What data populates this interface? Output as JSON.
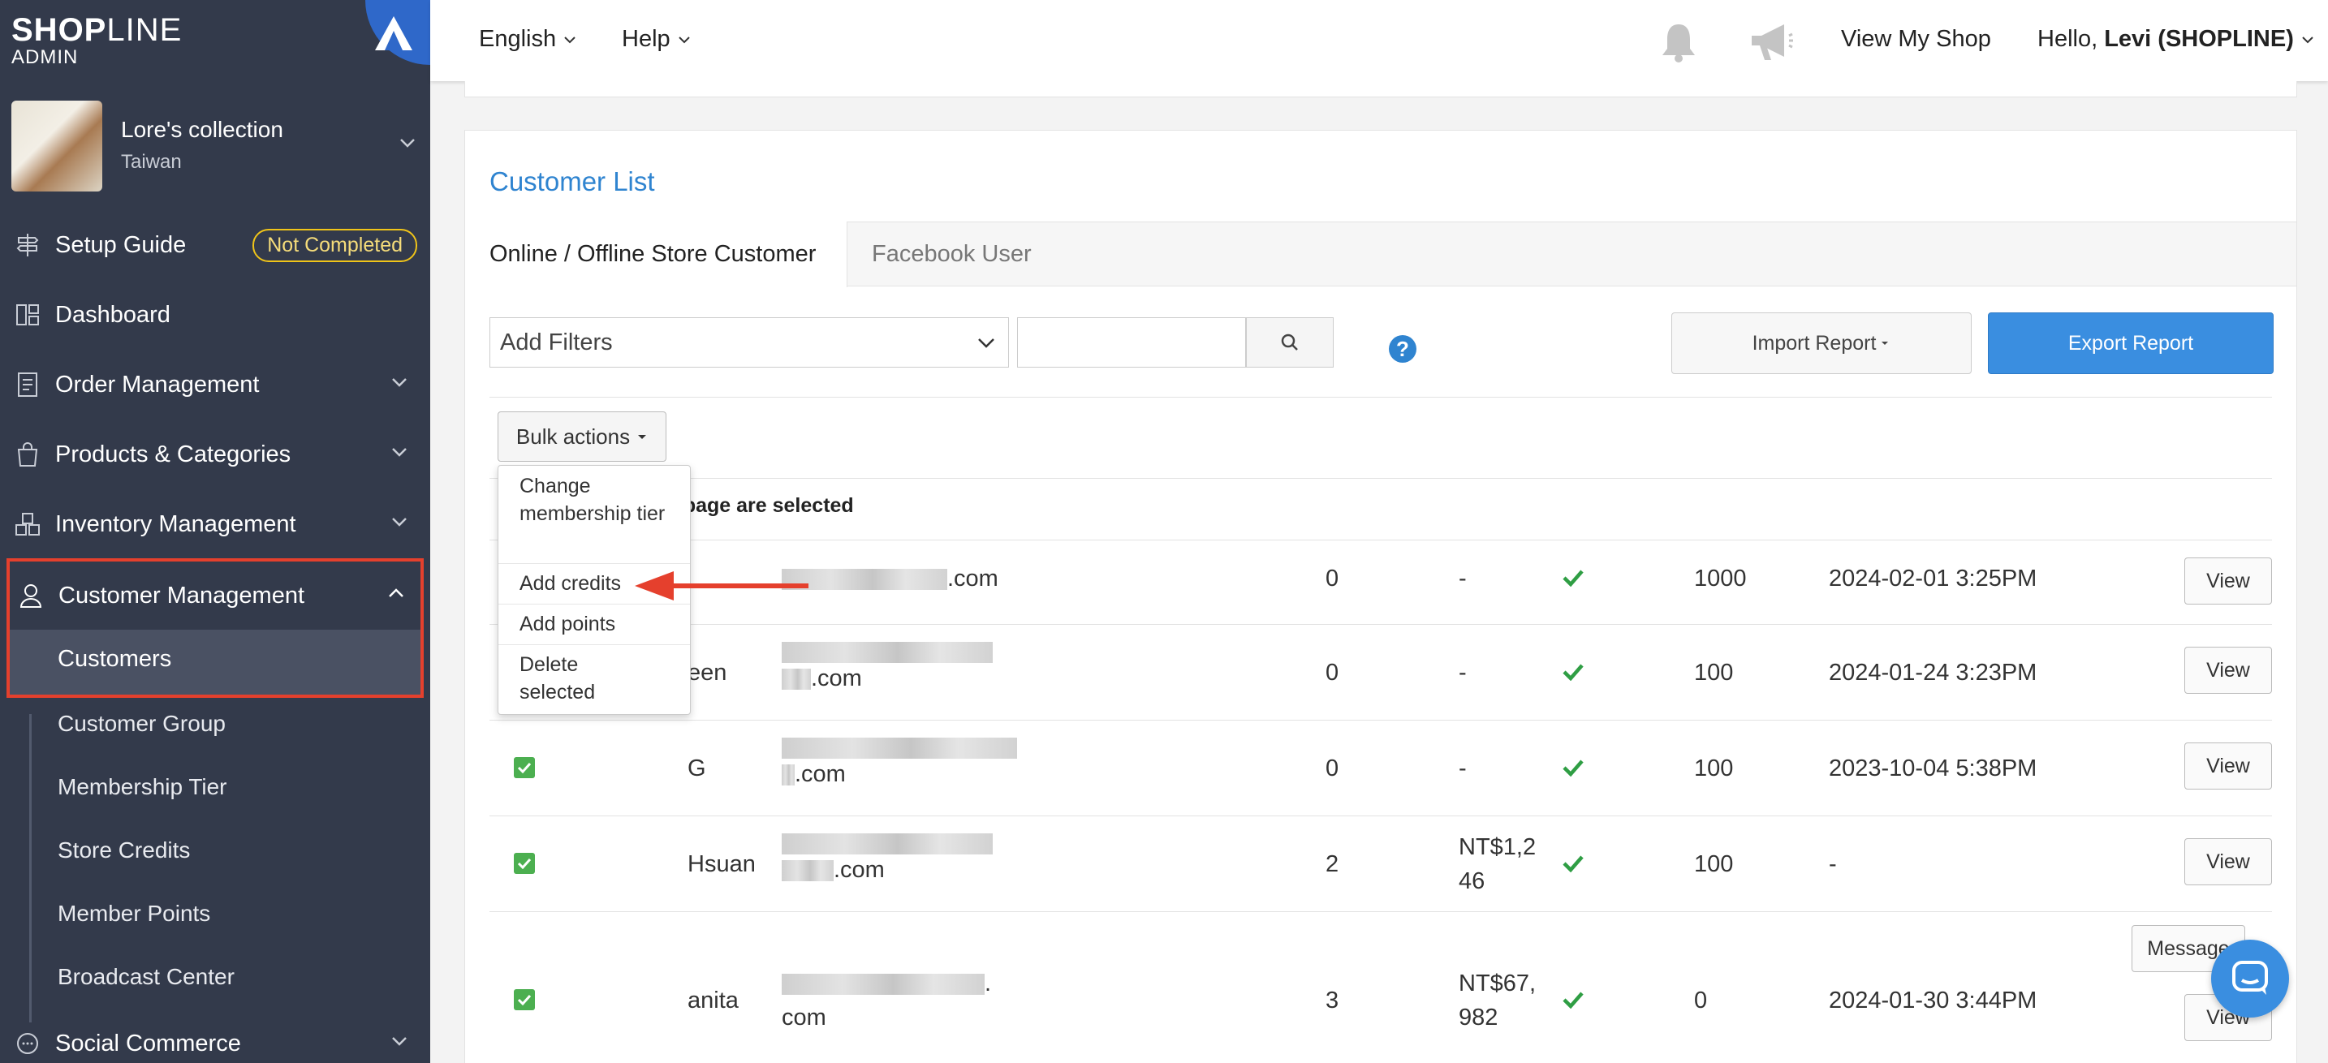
{
  "sidebar": {
    "logo": {
      "main_bold": "SHOP",
      "main_thin": "LINE",
      "sub": "ADMIN"
    },
    "store": {
      "name": "Lore's collection",
      "location": "Taiwan"
    },
    "items": [
      {
        "label": "Setup Guide",
        "badge": "Not Completed",
        "icon": "signpost-icon"
      },
      {
        "label": "Dashboard",
        "icon": "dashboard-icon"
      },
      {
        "label": "Order Management",
        "icon": "order-icon"
      },
      {
        "label": "Products & Categories",
        "icon": "bag-icon"
      },
      {
        "label": "Inventory Management",
        "icon": "boxes-icon"
      },
      {
        "label": "Customer Management",
        "icon": "user-icon"
      },
      {
        "label": "Social Commerce",
        "icon": "chat-icon"
      }
    ],
    "customer_sub": [
      "Customers",
      "Customer Group",
      "Membership Tier",
      "Store Credits",
      "Member Points",
      "Broadcast Center"
    ]
  },
  "topbar": {
    "language": "English",
    "help": "Help",
    "view_shop": "View My Shop",
    "greeting": "Hello, ",
    "user": "Levi (SHOPLINE)"
  },
  "main": {
    "title": "Customer List",
    "tabs": [
      "Online / Offline Store Customer",
      "Facebook User"
    ],
    "filter_placeholder": "Add Filters",
    "import_label": "Import Report",
    "export_label": "Export Report",
    "bulk_label": "Bulk actions",
    "selected_msg": "s page are selected",
    "dropdown": [
      "Change membership tier",
      "Add credits",
      "Add points",
      "Delete selected"
    ],
    "view_label": "View",
    "message_label": "Message"
  },
  "rows": [
    {
      "name": "",
      "email_tail": ".com",
      "orders": "0",
      "spent": "-",
      "points": "1000",
      "date": "2024-02-01 3:25PM"
    },
    {
      "name": "een",
      "email_tail": ".com",
      "orders": "0",
      "spent": "-",
      "points": "100",
      "date": "2024-01-24 3:23PM"
    },
    {
      "name": "G",
      "email_tail": ".com",
      "orders": "0",
      "spent": "-",
      "points": "100",
      "date": "2023-10-04 5:38PM"
    },
    {
      "name": "Hsuan",
      "email_tail": ".com",
      "orders": "2",
      "spent_l1": "NT$1,2",
      "spent_l2": "46",
      "points": "100",
      "date": "-"
    },
    {
      "name": "anita",
      "email_tail_l1": ".",
      "email_tail_l2": "com",
      "orders": "3",
      "spent_l1": "NT$67,",
      "spent_l2": "982",
      "points": "0",
      "date": "2024-01-30 3:44PM"
    }
  ],
  "colors": {
    "sidebar": "#333a4b",
    "accent": "#3a8ee0",
    "highlight": "#e5402d",
    "check": "#4caf50"
  }
}
